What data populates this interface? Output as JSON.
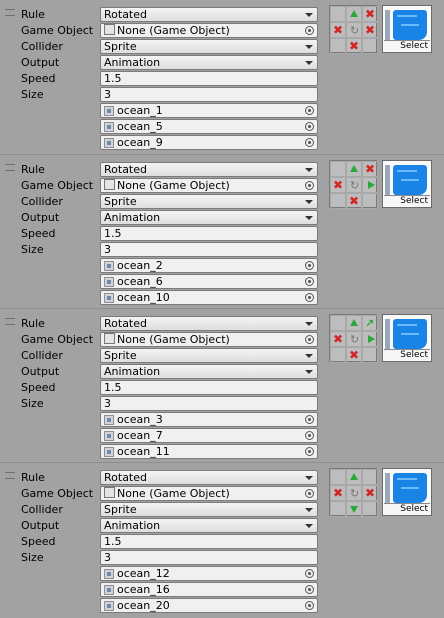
{
  "labels": {
    "rule": "Rule",
    "game_object": "Game Object",
    "collider": "Collider",
    "output": "Output",
    "speed": "Speed",
    "size": "Size"
  },
  "rules": [
    {
      "rule": "Rotated",
      "game_object": "None (Game Object)",
      "collider": "Sprite",
      "output": "Animation",
      "speed": "1.5",
      "size": "3",
      "sprites": [
        "ocean_1",
        "ocean_5",
        "ocean_9"
      ],
      "neighbors": [
        "",
        "arrow-up",
        "x",
        "x",
        "rotate",
        "x",
        "",
        "x",
        ""
      ],
      "select_label": "Select"
    },
    {
      "rule": "Rotated",
      "game_object": "None (Game Object)",
      "collider": "Sprite",
      "output": "Animation",
      "speed": "1.5",
      "size": "3",
      "sprites": [
        "ocean_2",
        "ocean_6",
        "ocean_10"
      ],
      "neighbors": [
        "",
        "arrow-up",
        "x",
        "x",
        "rotate",
        "arrow-right",
        "",
        "x",
        ""
      ],
      "select_label": "Select"
    },
    {
      "rule": "Rotated",
      "game_object": "None (Game Object)",
      "collider": "Sprite",
      "output": "Animation",
      "speed": "1.5",
      "size": "3",
      "sprites": [
        "ocean_3",
        "ocean_7",
        "ocean_11"
      ],
      "neighbors": [
        "",
        "arrow-up",
        "arrow-up-right",
        "x",
        "rotate",
        "arrow-right",
        "",
        "x",
        ""
      ],
      "select_label": "Select"
    },
    {
      "rule": "Rotated",
      "game_object": "None (Game Object)",
      "collider": "Sprite",
      "output": "Animation",
      "speed": "1.5",
      "size": "3",
      "sprites": [
        "ocean_12",
        "ocean_16",
        "ocean_20"
      ],
      "neighbors": [
        "",
        "arrow-up",
        "",
        "x",
        "rotate",
        "x",
        "",
        "arrow-down",
        ""
      ],
      "select_label": "Select"
    }
  ],
  "colors": {
    "background": "#a2a2a2",
    "green_arrow": "#2aa83a",
    "red_x": "#d22727",
    "water": "#1a84e6"
  }
}
